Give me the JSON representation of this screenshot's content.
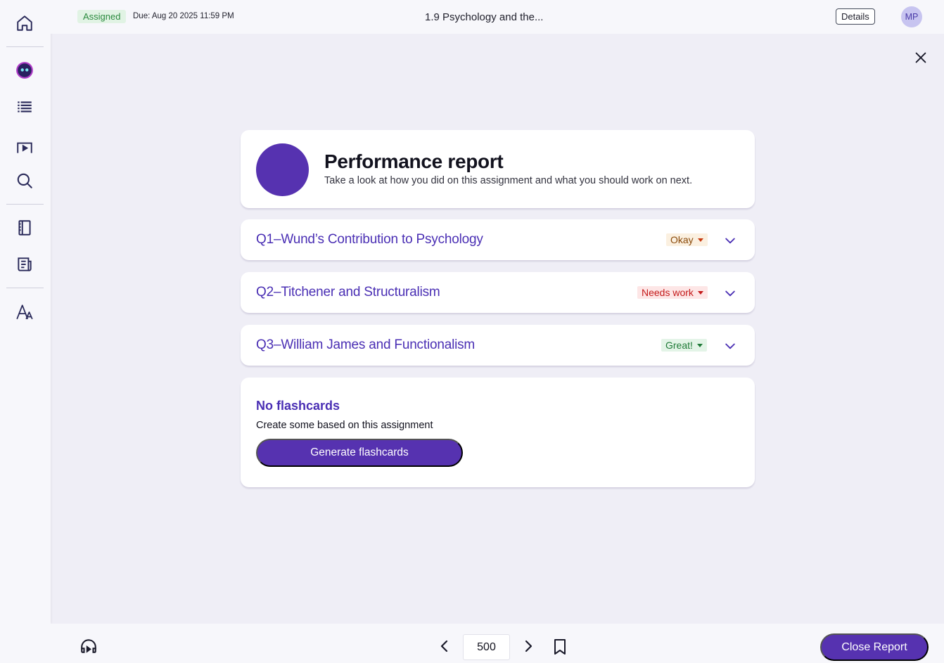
{
  "sidebar": {
    "items": [
      {
        "name": "home-icon"
      },
      {
        "name": "ai-assistant-icon"
      },
      {
        "name": "list-icon"
      },
      {
        "name": "video-icon"
      },
      {
        "name": "search-icon"
      },
      {
        "name": "notebook-icon"
      },
      {
        "name": "reading-icon"
      },
      {
        "name": "text-size-icon"
      }
    ]
  },
  "header": {
    "status_badge": "Assigned",
    "due": "Due: Aug 20 2025 11:59 PM",
    "title": "1.9  Psychology and the...",
    "details_label": "Details",
    "avatar_initials": "MP"
  },
  "report": {
    "title": "Performance report",
    "subtitle": "Take a look at how you did on this assignment and what you should work on next.",
    "questions": [
      {
        "title": "Q1–Wund’s Contribution to Psychology",
        "rating": "Okay",
        "rating_color": "#8a4a0a"
      },
      {
        "title": "Q2–Titchener and Structuralism",
        "rating": "Needs work",
        "rating_color": "#c41a1a"
      },
      {
        "title": "Q3–William James and Functionalism",
        "rating": "Great!",
        "rating_color": "#1f7a37"
      }
    ]
  },
  "flashcards": {
    "title": "No flashcards",
    "subtitle": "Create some based on this assignment",
    "button_label": "Generate flashcards"
  },
  "footer": {
    "page_number": "500",
    "close_label": "Close Report"
  },
  "colors": {
    "accent": "#5632b0",
    "link": "#4a2fb4",
    "background": "#efeef6"
  }
}
